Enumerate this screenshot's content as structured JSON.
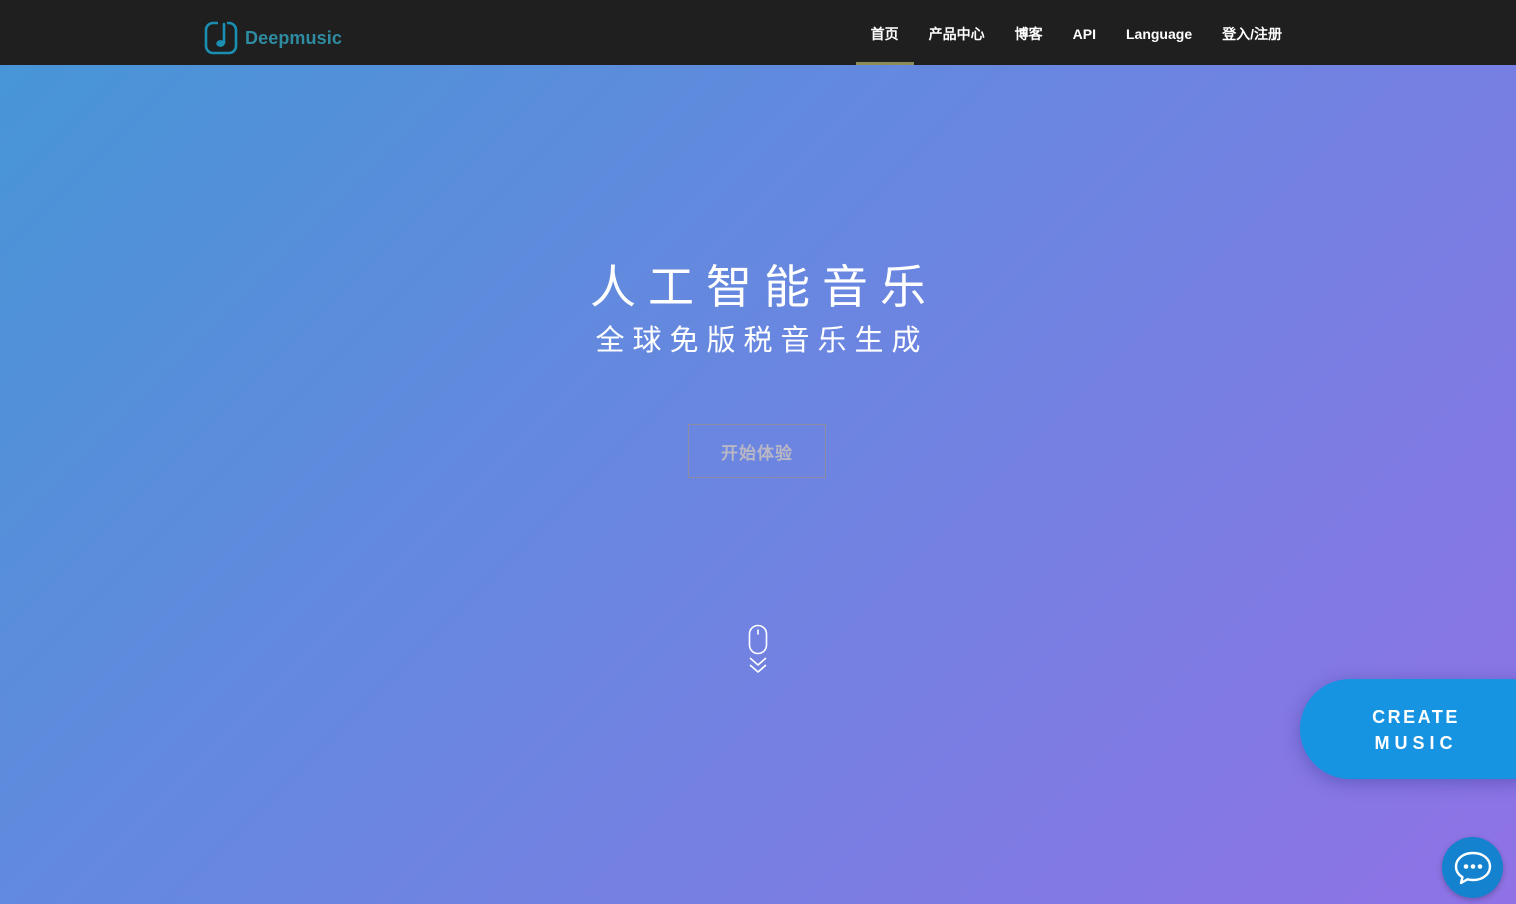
{
  "brand": {
    "name": "Deepmusic",
    "logo_icon": "music-note-icon",
    "color": "#2e8ba0"
  },
  "nav": {
    "items": [
      {
        "label": "首页",
        "active": true
      },
      {
        "label": "产品中心",
        "active": false
      },
      {
        "label": "博客",
        "active": false
      },
      {
        "label": "API",
        "active": false
      },
      {
        "label": "Language",
        "active": false
      },
      {
        "label": "登入/注册",
        "active": false
      }
    ],
    "active_indicator_color": "#8d8b57"
  },
  "hero": {
    "title": "人工智能音乐",
    "subtitle": "全球免版税音乐生成",
    "start_button_label": "开始体验",
    "scroll_icon": "mouse-scroll-icon"
  },
  "floating": {
    "create_line1": "CREATE",
    "create_line2": "MUSIC",
    "create_color": "#1694e2",
    "chat_icon": "chat-bubble-icon",
    "chat_color": "#1582cf"
  },
  "colors": {
    "navbar": "#1f1f1f",
    "gradient_start": "#4596d6",
    "gradient_end": "#9072e6"
  }
}
